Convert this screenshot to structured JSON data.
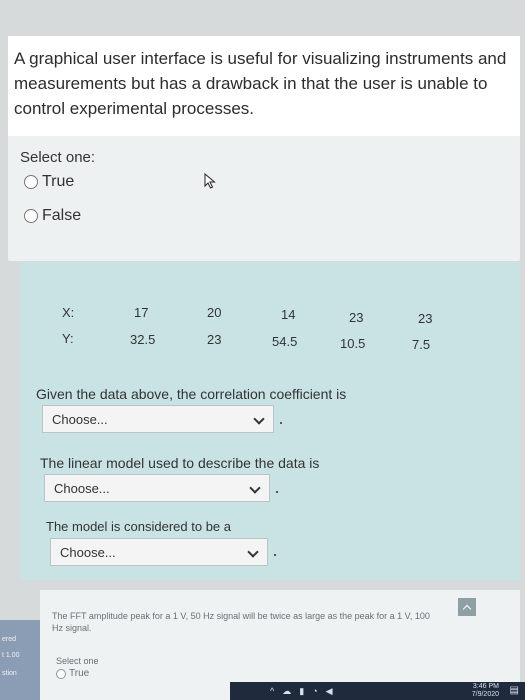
{
  "question1": {
    "text": "A graphical user interface is useful for visualizing instruments and measurements but has a drawback in that the user is unable to control experimental processes.",
    "select_one": "Select one:",
    "options": [
      "True",
      "False"
    ]
  },
  "data_table": {
    "x_label": "X:",
    "y_label": "Y:",
    "x_values": [
      "17",
      "20",
      "14",
      "23",
      "23"
    ],
    "y_values": [
      "32.5",
      "23",
      "54.5",
      "10.5",
      "7.5"
    ]
  },
  "questions": [
    {
      "prompt": "Given the data above, the correlation coefficient is",
      "value": "Choose..."
    },
    {
      "prompt": "The linear model used to describe the data is",
      "value": "Choose..."
    },
    {
      "prompt": "The model is considered to be a",
      "value": "Choose..."
    }
  ],
  "question_next": {
    "text": "The FFT amplitude peak for a 1 V, 50 Hz signal will be twice as large as the peak for a 1 V, 100 Hz signal.",
    "select_one": "Select one",
    "option": "True"
  },
  "left_strip": {
    "labels": [
      "ered",
      "t 1.00",
      "stion"
    ]
  },
  "taskbar": {
    "time": "3:46 PM",
    "date": "7/9/2020"
  },
  "colors": {
    "page_bg": "#d6dadb",
    "data_card_bg": "#c9e3e4",
    "taskbar_bg": "#1f2a3d"
  }
}
